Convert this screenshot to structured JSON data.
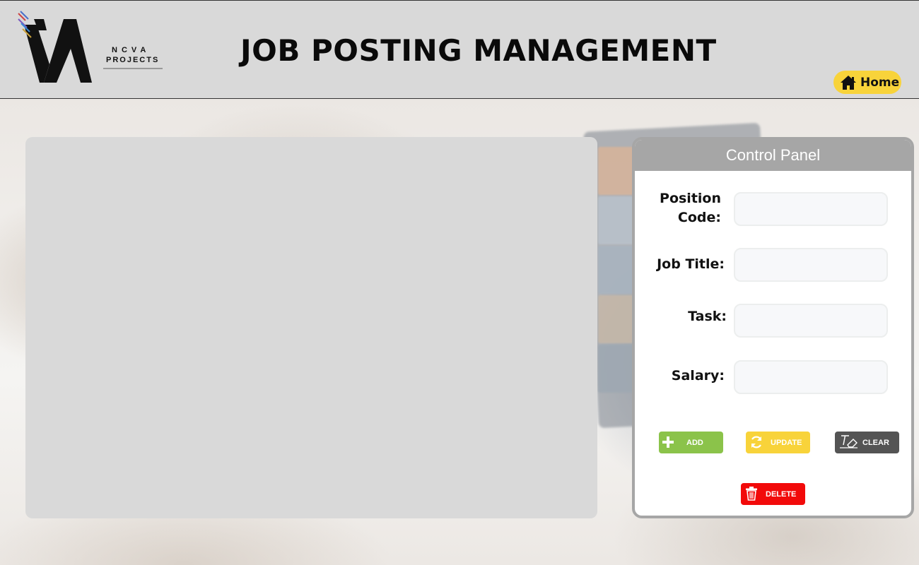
{
  "colors": {
    "header_bg": "#d9d9d9",
    "home_btn": "#f8d33a",
    "panel_gray": "#a6a6a6",
    "add_green": "#8bc34a",
    "update_yellow": "#f8d33a",
    "clear_dark": "#545454",
    "delete_red": "#f20a0a"
  },
  "header": {
    "logo_line1": "NCVA",
    "logo_line2": "PROJECTS",
    "title": "JOB POSTING MANAGEMENT",
    "home_label": "Home",
    "home_icon": "house-icon"
  },
  "control_panel": {
    "title": "Control Panel",
    "fields": [
      {
        "label_line1": "Position",
        "label_line2": "Code:",
        "value": ""
      },
      {
        "label": "Job Title:",
        "value": ""
      },
      {
        "label": "Task:",
        "value": ""
      },
      {
        "label": "Salary:",
        "value": ""
      }
    ],
    "buttons": {
      "add": {
        "label": "ADD",
        "icon": "plus-icon"
      },
      "update": {
        "label": "UPDATE",
        "icon": "refresh-icon"
      },
      "clear": {
        "label": "CLEAR",
        "icon": "eraser-icon"
      },
      "delete": {
        "label": "DELETE",
        "icon": "trash-icon"
      }
    }
  }
}
